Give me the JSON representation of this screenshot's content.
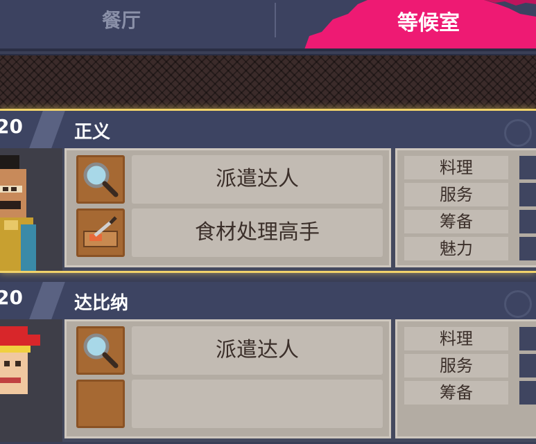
{
  "tabs": {
    "restaurant": "餐厅",
    "waiting_room": "等候室"
  },
  "characters": [
    {
      "level": "20",
      "name": "正义",
      "skills": [
        {
          "label": "派遣达人",
          "icon": "magnifier-icon"
        },
        {
          "label": "食材处理高手",
          "icon": "knife-cutting-board-icon"
        }
      ],
      "stats": [
        "料理",
        "服务",
        "筹备",
        "魅力"
      ]
    },
    {
      "level": "20",
      "name": "达比纳",
      "skills": [
        {
          "label": "派遣达人",
          "icon": "magnifier-icon"
        },
        {
          "label": "",
          "icon": "knife-cutting-board-icon"
        }
      ],
      "stats": [
        "料理",
        "服务",
        "筹备"
      ]
    }
  ],
  "colors": {
    "active_tab": "#ee1a73",
    "selected_border": "#f1d36a",
    "tab_bar": "#3c4260"
  }
}
